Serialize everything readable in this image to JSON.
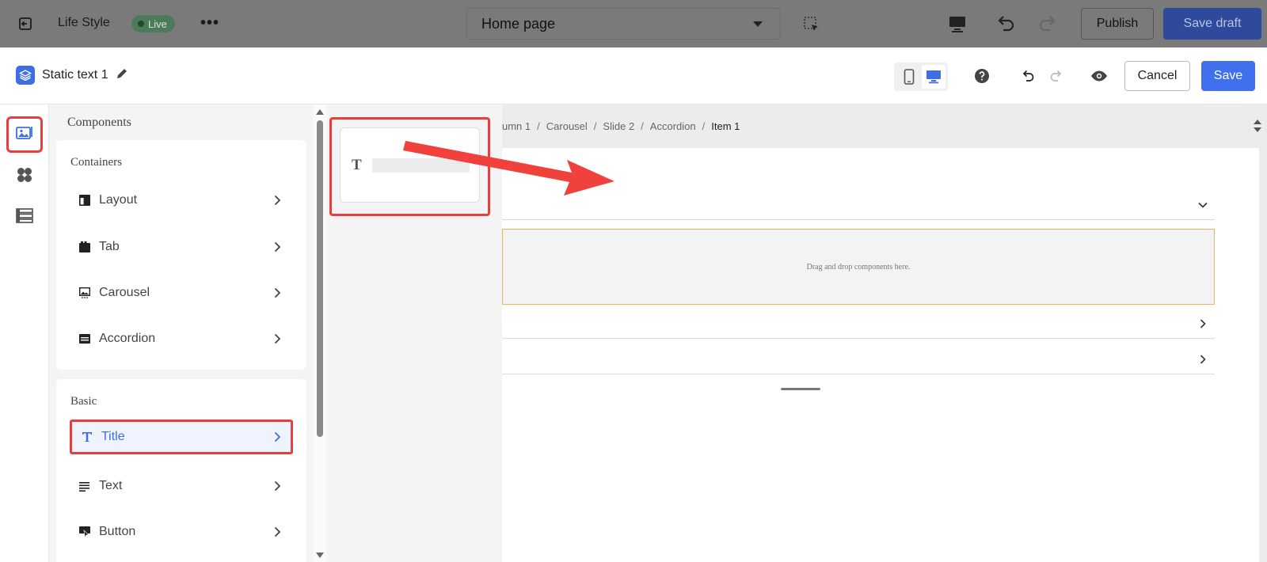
{
  "topbar": {
    "store_name": "Life Style",
    "status_badge": "Live",
    "more_glyph": "•••",
    "page_selector_value": "Home page",
    "publish_label": "Publish",
    "save_draft_label": "Save draft"
  },
  "editor_header": {
    "component_name": "Static text 1",
    "cancel_label": "Cancel",
    "save_label": "Save",
    "active_device": "desktop"
  },
  "panel": {
    "title": "Components",
    "containers": {
      "title": "Containers",
      "items": [
        {
          "label": "Layout",
          "icon": "layout-icon"
        },
        {
          "label": "Tab",
          "icon": "tab-icon"
        },
        {
          "label": "Carousel",
          "icon": "carousel-icon"
        },
        {
          "label": "Accordion",
          "icon": "accordion-icon"
        }
      ]
    },
    "basic": {
      "title": "Basic",
      "items": [
        {
          "label": "Title",
          "icon": "title-t-icon",
          "selected": true
        },
        {
          "label": "Text",
          "icon": "text-lines-icon"
        },
        {
          "label": "Button",
          "icon": "button-icon"
        }
      ]
    }
  },
  "preview": {
    "glyph": "T"
  },
  "canvas": {
    "breadcrumb": [
      "umn 1",
      "Carousel",
      "Slide 2",
      "Accordion",
      "Item 1"
    ],
    "breadcrumb_sep": "/",
    "dropzone_text": "Drag and drop components here."
  },
  "colors": {
    "accent": "#4170ee",
    "highlight_red": "#e5403d",
    "dropzone_border": "#f0b066"
  }
}
